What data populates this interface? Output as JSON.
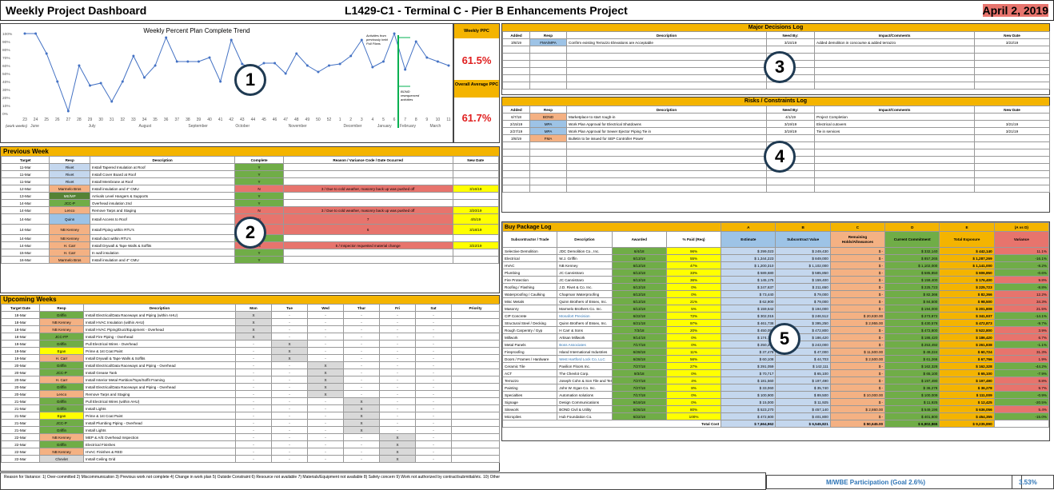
{
  "header": {
    "left": "Weekly Project Dashboard",
    "center": "L1429-C1 - Terminal C - Pier B Enhancements Project",
    "right": "April 2, 2019"
  },
  "trend": {
    "title": "Weekly Percent Plan Complete Trend",
    "yticks": [
      "100%",
      "90%",
      "80%",
      "70%",
      "60%",
      "50%",
      "40%",
      "30%",
      "20%",
      "10%",
      "0%"
    ],
    "weeks": [
      "23",
      "24",
      "25",
      "26",
      "27",
      "28",
      "29",
      "30",
      "31",
      "32",
      "33",
      "34",
      "35",
      "36",
      "37",
      "38",
      "39",
      "40",
      "41",
      "42",
      "43",
      "44",
      "45",
      "46",
      "47",
      "48",
      "49",
      "50",
      "52",
      "1",
      "2",
      "3",
      "4",
      "5",
      "6",
      "7",
      "8",
      "9",
      "10",
      "11"
    ],
    "months": [
      "June",
      "July",
      "August",
      "September",
      "October",
      "November",
      "December",
      "January",
      "February",
      "March"
    ],
    "weeks_label": "(work weeks)",
    "values": [
      100,
      100,
      75,
      40,
      3,
      60,
      35,
      38,
      15,
      40,
      72,
      45,
      60,
      95,
      65,
      65,
      65,
      70,
      40,
      92,
      62,
      55,
      63,
      63,
      50,
      75,
      60,
      52,
      60,
      62,
      72,
      92,
      58,
      65,
      100,
      55,
      90,
      70,
      65,
      60
    ],
    "note1": "Activities from previously held Pull Plans",
    "note2": "BOND resequenced activities"
  },
  "ppc": {
    "weekly_label": "Weekly PPC",
    "weekly_value": "61.5%",
    "avg_label": "Overall Average PPC",
    "avg_value": "61.7%"
  },
  "circles": [
    "1",
    "2",
    "3",
    "4",
    "5"
  ],
  "prev": {
    "title": "Previous Week",
    "headers": [
      "Target",
      "Resp",
      "Description",
      "Complete",
      "Reason / Variance Code / Date Occurred",
      "New Date"
    ],
    "rows": [
      [
        "11-Mar",
        "Rivet",
        "Install Tapered Insulation at Roof",
        "Y",
        "",
        ""
      ],
      [
        "11-Mar",
        "Rivet",
        "Install Cover Board at Roof",
        "Y",
        "",
        ""
      ],
      [
        "11-Mar",
        "Rivet",
        "Install Membrane at Roof",
        "Y",
        "",
        ""
      ],
      [
        "12-Mar",
        "Marmelo Bros",
        "Install insulation and 4\" CMU",
        "N",
        "3 / Due to cold weather, masonry back up was pushed off",
        "3/16/19"
      ],
      [
        "13-Mar",
        "ME/MP",
        "Arrivals Level Hangers & Supports",
        "Y",
        "",
        ""
      ],
      [
        "14-Mar",
        "JCC-P",
        "Overhead insulation 2nd",
        "Y",
        "",
        ""
      ],
      [
        "14-Mar",
        "Lenco",
        "Remove Tarps and Staging",
        "N",
        "3 / Due to cold weather, masonry back up was pushed off",
        "3/20/19"
      ],
      [
        "14-Mar",
        "Quinn",
        "Install Access to Roof",
        "N",
        "7",
        "4/5/19"
      ],
      [
        "14-Mar",
        "NB Kenney",
        "Install Piping within RTU's",
        "N",
        "6",
        "3/18/19"
      ],
      [
        "14-Mar",
        "NB Kenney",
        "Install duct within RTU's",
        "Y",
        "",
        ""
      ],
      [
        "14-Mar",
        "H. Carr",
        "Install Drywall & Tape Walls & Soffits",
        "N",
        "5 / Inspector requested material change",
        "3/22/19"
      ],
      [
        "15-Mar",
        "H. Carr",
        "In wall insulation",
        "Y",
        "",
        ""
      ],
      [
        "16-Mar",
        "Marmelo Bros",
        "Install insulation and 4\" CMU",
        "Y",
        "",
        ""
      ]
    ]
  },
  "upcoming": {
    "title": "Upcoming Weeks",
    "headers": [
      "Target Date",
      "Resp",
      "Description",
      "Mon",
      "Tue",
      "Wed",
      "Thur",
      "Fri",
      "Sat",
      "Priority"
    ],
    "rows": [
      [
        "18-Mar",
        "Griffin",
        "Install Electrical/Data Raceways and Piping (within AHU)",
        "X",
        "-",
        "-",
        "-",
        "-",
        "-",
        ""
      ],
      [
        "18-Mar",
        "NB Kenney",
        "Install HVAC Insulation (within AHU)",
        "X",
        "-",
        "-",
        "-",
        "-",
        "-",
        ""
      ],
      [
        "18-Mar",
        "NB Kenney",
        "Install HVAC Piping/Duct/Equipment - Overhead",
        "X",
        "-",
        "-",
        "-",
        "-",
        "-",
        ""
      ],
      [
        "18-Mar",
        "JCC-FP",
        "Install Fire Piping - Overhead",
        "X",
        "-",
        "-",
        "-",
        "-",
        "-",
        ""
      ],
      [
        "19-Mar",
        "Griffin",
        "Pull Electrical Wires - Overhead",
        "-",
        "X",
        "-",
        "-",
        "-",
        "-",
        ""
      ],
      [
        "19-Mar",
        "Egan",
        "Prime & 1st Coat Paint",
        "-",
        "X",
        "-",
        "-",
        "-",
        "-",
        ""
      ],
      [
        "19-Mar",
        "H. Carr",
        "Install Drywall & Tape Walls & Soffits",
        "-",
        "X",
        "-",
        "-",
        "-",
        "-",
        ""
      ],
      [
        "20-Mar",
        "Griffin",
        "Install Electrical/Data Raceways and Piping - Overhead",
        "-",
        "-",
        "X",
        "-",
        "-",
        "-",
        ""
      ],
      [
        "20-Mar",
        "JCC-P",
        "Install Grease Tank",
        "-",
        "-",
        "X",
        "-",
        "-",
        "-",
        ""
      ],
      [
        "20-Mar",
        "H. Carr",
        "Install Interior Metal Partition/Tops/Soffit Framing",
        "-",
        "-",
        "X",
        "-",
        "-",
        "-",
        ""
      ],
      [
        "20-Mar",
        "Griffin",
        "Install Electrical/Data Raceways and Piping - Overhead",
        "-",
        "-",
        "X",
        "-",
        "-",
        "-",
        ""
      ],
      [
        "20-Mar",
        "Lenco",
        "Remove Tarps and Staging",
        "-",
        "-",
        "X",
        "-",
        "-",
        "-",
        ""
      ],
      [
        "21-Mar",
        "Griffin",
        "Pull Electrical Wires (within AHU)",
        "-",
        "-",
        "-",
        "X",
        "-",
        "-",
        ""
      ],
      [
        "21-Mar",
        "Griffin",
        "Install Lights",
        "-",
        "-",
        "-",
        "X",
        "-",
        "-",
        ""
      ],
      [
        "21-Mar",
        "Egan",
        "Prime & 1st Coat Paint",
        "-",
        "-",
        "-",
        "X",
        "-",
        "-",
        ""
      ],
      [
        "21-Mar",
        "JCC-P",
        "Install Plumbing Piping - Overhead",
        "-",
        "-",
        "-",
        "X",
        "-",
        "-",
        ""
      ],
      [
        "21-Mar",
        "Griffin",
        "Install Lights",
        "-",
        "-",
        "-",
        "X",
        "-",
        "-",
        ""
      ],
      [
        "22-Mar",
        "NB Kenney",
        "MEP & A/E Overhead Inspection",
        "-",
        "-",
        "-",
        "-",
        "X",
        "-",
        ""
      ],
      [
        "22-Mar",
        "Griffin",
        "Electrical Finishes",
        "-",
        "-",
        "-",
        "-",
        "X",
        "-",
        ""
      ],
      [
        "22-Mar",
        "NB Kenney",
        "HVAC Finishes & RED",
        "-",
        "-",
        "-",
        "-",
        "X",
        "-",
        ""
      ],
      [
        "22-Mar",
        "Chevlet",
        "Install Ceiling Grid",
        "-",
        "-",
        "-",
        "-",
        "X",
        "-",
        ""
      ]
    ]
  },
  "footer": "Reason for Variance: 1) Over-committed 2) Miscommunication 3) Previous work not complete 4) Change in work plan 5) Outside Constraint 6) Resource not available 7) Materials/Equipment not available 8) Safety concern 9) Work not authorized by contract/submittal/etc. 10) Other",
  "mwbe": {
    "label": "M/WBE Participation (Goal 2.6%)",
    "value": "3.53%"
  },
  "decisions": {
    "title": "Major Decisions Log",
    "headers": [
      "Added",
      "Resp",
      "Description",
      "Need By:",
      "Impact/Comments",
      "New Date"
    ],
    "rows": [
      [
        "3/8/19",
        "FMA/MPA",
        "Confirm existing Terrazzo Elevations are Acceptable",
        "3/15/19",
        "Added demolition in concourse & added terrazzo",
        "3/22/19"
      ]
    ]
  },
  "risks": {
    "title": "Risks / Constraints Log",
    "headers": [
      "Added",
      "Resp",
      "Description",
      "Need By:",
      "Impact/Comments",
      "New Date"
    ],
    "rows": [
      [
        "6/7/18",
        "BOND",
        "Marketplace to start rough-in",
        "4/1/19",
        "Project Completion",
        ""
      ],
      [
        "2/15/19",
        "MPA",
        "Work Plan Approval for Electrical Shutdowns",
        "3/19/19",
        "Electrical cutovers",
        "3/21/19"
      ],
      [
        "2/27/19",
        "MPA",
        "Work Plan Approval for Sewer Ejector Piping Tie in",
        "3/19/19",
        "Tie in services",
        "3/21/19"
      ],
      [
        "3/8/19",
        "FMA",
        "Bulletin to be issued for SEP Controller Power",
        "",
        ""
      ]
    ]
  },
  "buy": {
    "title": "Buy Package Log",
    "letters": [
      "A",
      "B",
      "C",
      "D",
      "E",
      "(A vs D)"
    ],
    "headers": [
      "Subcontractor / Trade",
      "Description",
      "Awarded",
      "% Paid (Req)",
      "Estimate",
      "Subcontract Value",
      "Remaining Holds/Allowances",
      "Current Commitment",
      "Total Exposure",
      "Variance"
    ],
    "rows": [
      [
        "Selective Demolition",
        "JDC Demolition Co., Inc.",
        "6/4/18",
        "96%",
        "299,023",
        "249,430",
        "",
        "332,140",
        "442,140",
        "11.1%"
      ],
      [
        "Electrical",
        "W.J. Griffin",
        "6/13/18",
        "55%",
        "1,344,223",
        "849,000",
        "",
        "857,265",
        "1,287,269",
        "-16.1%"
      ],
      [
        "HVAC",
        "NB Kenney",
        "6/13/18",
        "47%",
        "1,200,310",
        "1,102,000",
        "",
        "1,102,000",
        "1,141,000",
        "-8.2%"
      ],
      [
        "Plumbing",
        "JC Cannistraro",
        "6/13/18",
        "33%",
        "589,680",
        "585,850",
        "",
        "585,850",
        "606,850",
        "-0.6%"
      ],
      [
        "Fire Protection",
        "JC Cannistraro",
        "6/13/18",
        "36%",
        "145,175",
        "159,400",
        "",
        "159,400",
        "176,400",
        "9.8%"
      ],
      [
        "Roofing / Flashing",
        "J.D. Rivet & Co. Inc.",
        "6/13/18",
        "0%",
        "247,637",
        "211,650",
        "",
        "225,723",
        "225,723",
        "-8.8%"
      ],
      [
        "Waterproofing / Caulking",
        "Chapman Waterproofing",
        "6/13/18",
        "0%",
        "73,440",
        "79,000",
        "",
        "82,366",
        "82,366",
        "12.2%"
      ],
      [
        "Misc Metals",
        "Quinn Brothers of Essex, Inc.",
        "6/13/18",
        "21%",
        "62,900",
        "79,000",
        "",
        "84,500",
        "98,500",
        "34.3%"
      ],
      [
        "Masonry",
        "Marmelo Brothers Co. Inc.",
        "6/13/18",
        "5%",
        "159,642",
        "194,000",
        "",
        "194,000",
        "201,808",
        "21.5%"
      ],
      [
        "CIP Concrete",
        "Monafort Precision",
        "6/22/18",
        "72%",
        "302,015",
        "246,512",
        "20,830.00",
        "273,872",
        "341,937",
        "-14.1%"
      ],
      [
        "Structural Steel / Decking",
        "Quinn Brothers of Essex, Inc.",
        "6/21/18",
        "97%",
        "461,738",
        "395,250",
        "2,955.00",
        "430,578",
        "472,873",
        "-9.7%"
      ],
      [
        "Rough Carpentry / Gyp",
        "H Carr & Sons",
        "7/3/18",
        "20%",
        "450,058",
        "472,800",
        "",
        "472,800",
        "522,800",
        "3.9%"
      ],
      [
        "Millwork",
        "Artisan Millwork",
        "9/14/18",
        "0%",
        "174,708",
        "186,420",
        "",
        "186,420",
        "186,420",
        "6.7%"
      ],
      [
        "Metal Panels",
        "Boss Associates",
        "7/17/18",
        "0%",
        "250,265",
        "243,000",
        "",
        "253,492",
        "261,838",
        "-1.1%"
      ],
      [
        "Fireproofing",
        "Island International Industries",
        "6/28/18",
        "11%",
        "37,478",
        "47,000",
        "11,500.00",
        "49,224",
        "60,724",
        "31.3%"
      ],
      [
        "Doors / Frames / Hardware",
        "West Hartford Lock Co, LLC",
        "6/28/18",
        "56%",
        "60,108",
        "44,703",
        "2,500.00",
        "61,266",
        "67,766",
        "1.9%"
      ],
      [
        "Ceramic Tile",
        "Pavilion Floors Inc.",
        "7/27/18",
        "27%",
        "291,059",
        "142,111",
        "",
        "162,328",
        "162,328",
        "-44.2%"
      ],
      [
        "ACT",
        "The Chevlot Corp.",
        "9/3/18",
        "0%",
        "70,717",
        "65,100",
        "",
        "65,100",
        "65,100",
        "-7.9%"
      ],
      [
        "Terrazzo",
        "Joseph Cohn & Son Tile and Terrazzo",
        "7/27/18",
        "4%",
        "181,560",
        "197,490",
        "",
        "197,490",
        "197,490",
        "8.8%"
      ],
      [
        "Painting",
        "John W. Egan Co. Inc.",
        "7/27/18",
        "8%",
        "33,060",
        "35,740",
        "",
        "36,278",
        "36,278",
        "9.7%"
      ],
      [
        "Specialties",
        "Automation solutions",
        "7/17/18",
        "0%",
        "100,900",
        "89,500",
        "10,000.00",
        "100,009",
        "111,009",
        "-0.9%"
      ],
      [
        "Signage",
        "Design Communications",
        "9/19/18",
        "0%",
        "15,000",
        "11,925",
        "",
        "11,925",
        "12,425",
        "-20.5%"
      ],
      [
        "Sitework",
        "BOND Civil & Utility",
        "6/26/18",
        "80%",
        "523,270",
        "457,140",
        "2,860.00",
        "549,196",
        "636,056",
        "5.4%"
      ],
      [
        "Micropiles",
        "Hub Foundation Co.",
        "6/22/18",
        "100%",
        "472,600",
        "401,800",
        "",
        "401,800",
        "454,355",
        "-15.0%"
      ]
    ],
    "total_label": "Total Cost",
    "totals": [
      "7,664,962",
      "6,545,821",
      "50,645.00",
      "6,902,865",
      "9,235,890"
    ]
  },
  "colors": {
    "accent": "#f4b400",
    "red_text": "#e02020",
    "blue_text": "#2e75b6"
  }
}
